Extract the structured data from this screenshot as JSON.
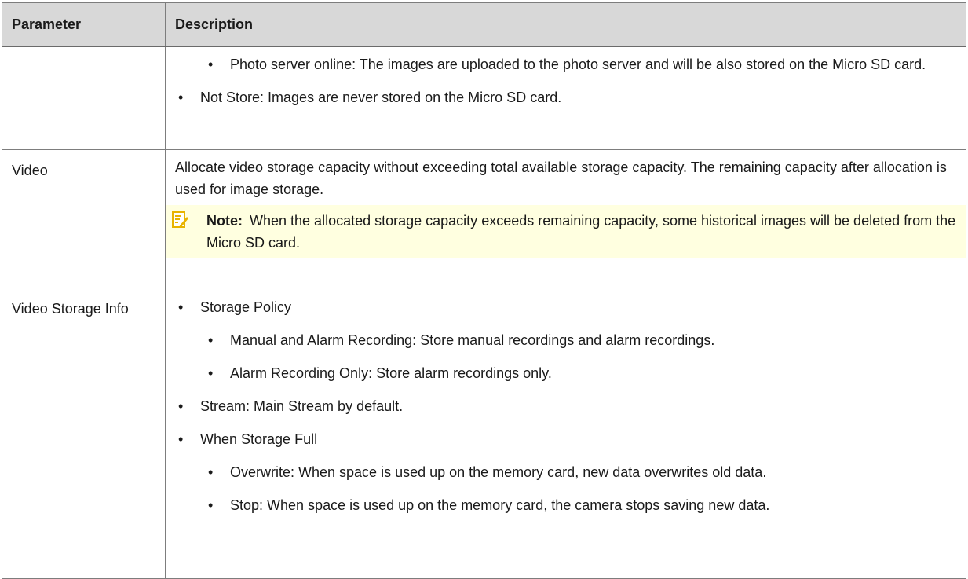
{
  "table": {
    "headers": {
      "parameter": "Parameter",
      "description": "Description"
    },
    "rows": {
      "snapshot_cont": {
        "parameter": "",
        "sub_bullet_1": "Photo server online: The images are uploaded to the photo server and will be also stored on the Micro SD card.",
        "bullet_1": "Not Store: Images are never stored on the Micro SD card."
      },
      "video": {
        "parameter": "Video",
        "description": "Allocate video storage capacity without exceeding total available storage capacity. The remaining capacity after allocation is used for image storage.",
        "note": {
          "icon": "note-pencil-icon",
          "label": "Note:",
          "text": "When the allocated storage capacity exceeds remaining capacity, some historical images will be deleted from the Micro SD card."
        }
      },
      "video_storage_info": {
        "parameter": "Video Storage Info",
        "storage_policy": "Storage Policy",
        "policy_manual_alarm": "Manual and Alarm Recording: Store manual recordings and alarm recordings.",
        "policy_alarm_only": "Alarm Recording Only: Store alarm recordings only.",
        "stream": "Stream: Main Stream by default.",
        "when_full": "When Storage Full",
        "full_overwrite": "Overwrite: When space is used up on the memory card, new data overwrites old data.",
        "full_stop": "Stop: When space is used up on the memory card, the camera stops saving new data."
      }
    },
    "bullet_char": "•"
  },
  "colors": {
    "header_bg": "#d8d8d8",
    "border": "#7d7d7d",
    "note_bg": "#ffffe0",
    "note_icon": "#e8b400"
  }
}
